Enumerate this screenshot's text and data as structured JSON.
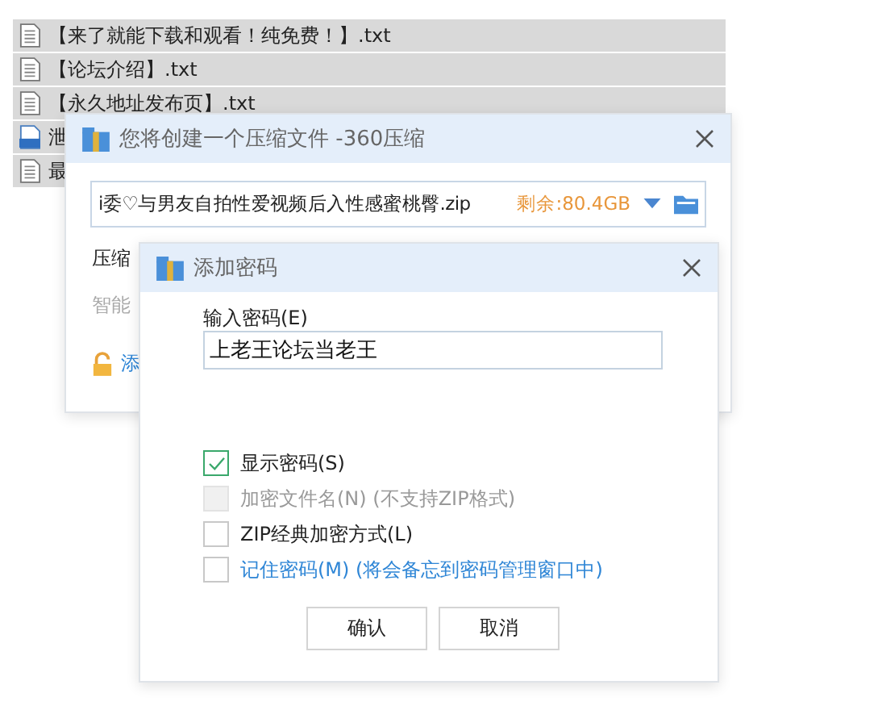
{
  "files": [
    {
      "kind": "txt",
      "name": "【来了就能下载和观看！纯免费！】.txt"
    },
    {
      "kind": "txt",
      "name": "【论坛介绍】.txt"
    },
    {
      "kind": "txt",
      "name": "【永久地址发布页】.txt"
    },
    {
      "kind": "mp4",
      "name": "泄"
    },
    {
      "kind": "txt",
      "name": "最"
    }
  ],
  "compress_window": {
    "title": "您将创建一个压缩文件 -360压缩",
    "filename": "i委♡与男友自拍性爱视频后入性感蜜桃臀.zip",
    "free_space": "剩余:80.4GB",
    "label_1": "压缩",
    "label_2": "智能",
    "link": "添"
  },
  "password_dialog": {
    "title": "添加密码",
    "field_label": "输入密码(E)",
    "password": "上老王论坛当老王",
    "options": [
      {
        "label": "显示密码(S)",
        "checked": true,
        "disabled": false,
        "kind": "plain"
      },
      {
        "label": "加密文件名(N) (不支持ZIP格式)",
        "checked": false,
        "disabled": true,
        "kind": "plain"
      },
      {
        "label": "ZIP经典加密方式(L)",
        "checked": false,
        "disabled": false,
        "kind": "plain"
      },
      {
        "label": "记住密码(M) (将会备忘到密码管理窗口中)",
        "checked": false,
        "disabled": false,
        "kind": "link"
      }
    ],
    "buttons": [
      "确认",
      "取消"
    ]
  }
}
